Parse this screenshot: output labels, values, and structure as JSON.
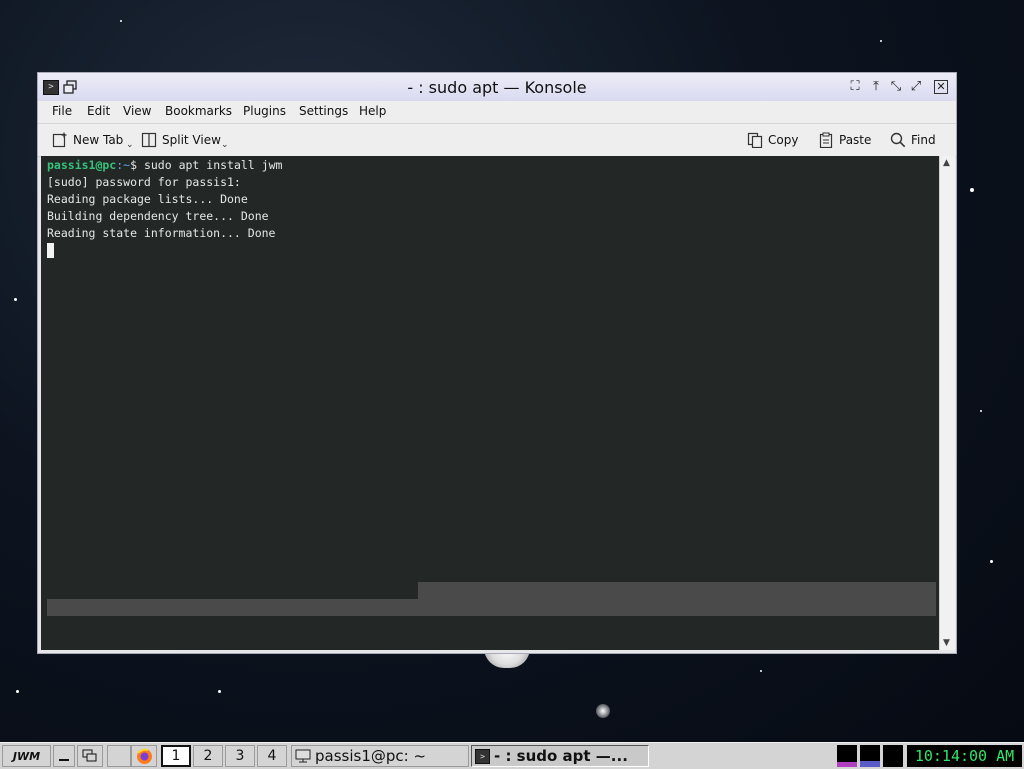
{
  "window": {
    "title": "- : sudo apt — Konsole",
    "app_icon_glyph": ">",
    "titlebar_buttons": [
      "fullscreen-icon",
      "keep-above-icon",
      "minimize-icon",
      "maximize-icon",
      "close-icon"
    ]
  },
  "menu": {
    "items": [
      "File",
      "Edit",
      "View",
      "Bookmarks",
      "Plugins",
      "Settings",
      "Help"
    ]
  },
  "toolbar": {
    "new_tab": "New Tab",
    "split_view": "Split View",
    "copy": "Copy",
    "paste": "Paste",
    "find": "Find"
  },
  "terminal": {
    "prompt_user": "passis1@pc",
    "prompt_path": ":~",
    "prompt_command": "$ sudo apt install jwm",
    "lines": [
      "[sudo] password for passis1:",
      "Reading package lists... Done",
      "Building dependency tree... Done",
      "Reading state information... Done"
    ]
  },
  "taskbar": {
    "menu_label": "JWM",
    "pager": [
      "1",
      "2",
      "3",
      "4"
    ],
    "active_desktop": "1",
    "tasks": [
      {
        "label": "passis1@pc: ~",
        "active": false
      },
      {
        "label": "- : sudo apt —...",
        "active": true
      }
    ],
    "clock": "10:14:00 AM"
  },
  "colors": {
    "terminal_bg": "#232827",
    "prompt_user": "#35c27a",
    "prompt_path": "#5aa7e6",
    "clock_text": "#2ee66b",
    "titlebar": "#d9daf0"
  }
}
